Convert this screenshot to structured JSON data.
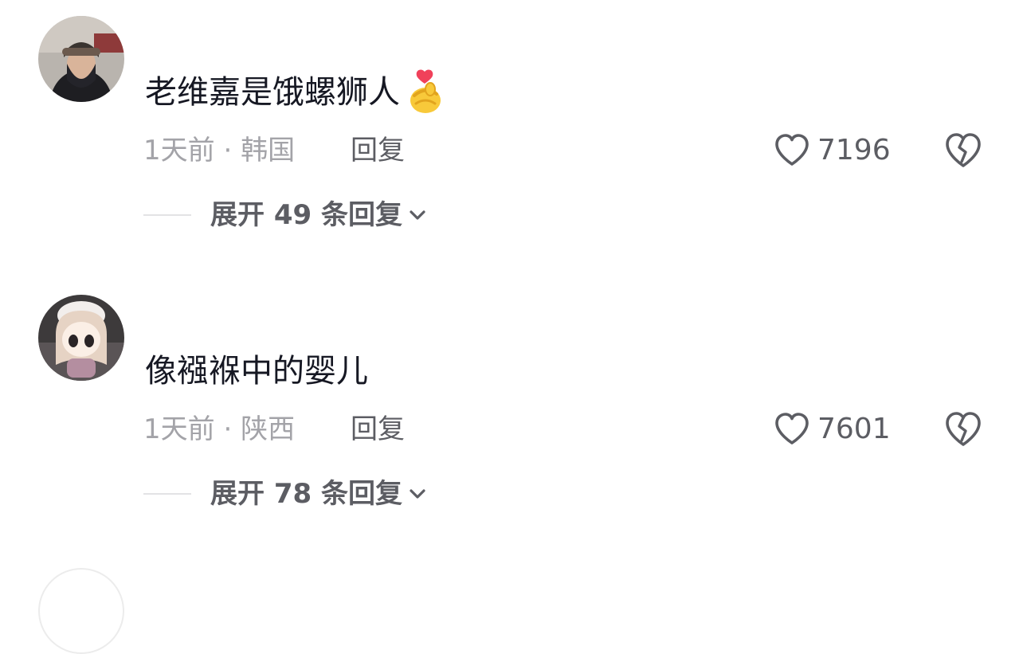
{
  "comments": [
    {
      "avatar": "user-avatar-man-cap",
      "text": "老维嘉是饿螺狮人",
      "emoji": "finger-heart-emoji",
      "time": "1天前",
      "separator": "·",
      "location": "韩国",
      "reply_label": "回复",
      "like_count": "7196",
      "expand_label": "展开 49 条回复"
    },
    {
      "avatar": "user-avatar-doll",
      "text": "像襁褓中的婴儿",
      "time": "1天前",
      "separator": "·",
      "location": "陕西",
      "reply_label": "回复",
      "like_count": "7601",
      "expand_label": "展开 78 条回复"
    }
  ],
  "icons": {
    "like": "heart-outline-icon",
    "dislike": "broken-heart-icon",
    "expand": "chevron-down-icon"
  },
  "colors": {
    "primary_text": "#161823",
    "secondary_text": "#a3a3a8",
    "action_text": "#5c5d63"
  }
}
